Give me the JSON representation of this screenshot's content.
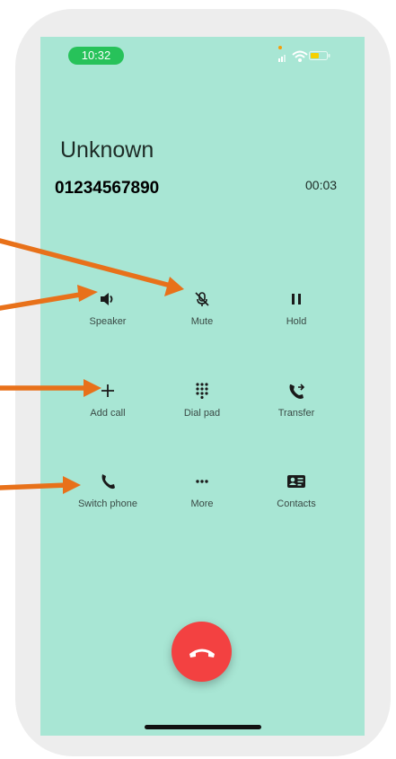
{
  "status_bar": {
    "time": "10:32"
  },
  "call": {
    "caller_name": "Unknown",
    "caller_number": "01234567890",
    "timer": "00:03"
  },
  "controls": [
    {
      "label": "Speaker",
      "icon": "speaker-icon"
    },
    {
      "label": "Mute",
      "icon": "mute-mic-icon"
    },
    {
      "label": "Hold",
      "icon": "pause-icon"
    },
    {
      "label": "Add call",
      "icon": "plus-icon"
    },
    {
      "label": "Dial pad",
      "icon": "dialpad-icon"
    },
    {
      "label": "Transfer",
      "icon": "transfer-icon"
    },
    {
      "label": "Switch phone",
      "icon": "phone-icon"
    },
    {
      "label": "More",
      "icon": "more-icon"
    },
    {
      "label": "Contacts",
      "icon": "contact-card-icon"
    }
  ],
  "colors": {
    "screen_bg": "#a8e6d4",
    "end_call": "#f34141",
    "time_pill": "#27c25a",
    "annotation_arrow": "#e8711a"
  }
}
